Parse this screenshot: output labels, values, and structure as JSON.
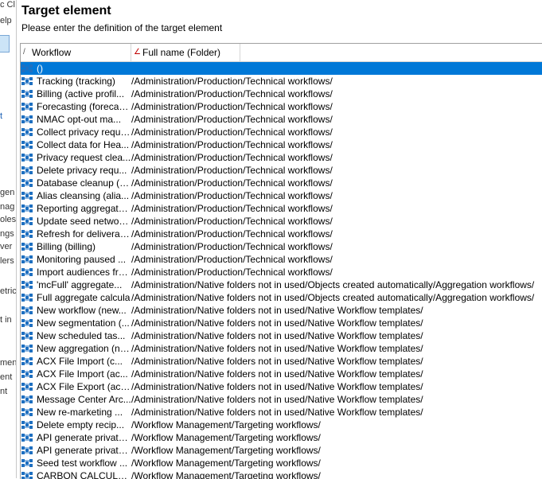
{
  "background_window": {
    "fragments": [
      "c Cl",
      "elp",
      "t",
      "gen",
      "nag",
      "oles",
      "ngs",
      "ver",
      "lers",
      "etric",
      "t in",
      "men",
      "ent",
      "nt"
    ]
  },
  "dialog": {
    "title": "Target element",
    "subtitle": "Please enter the definition of the target element"
  },
  "grid": {
    "columns": [
      {
        "label": "Workflow",
        "sort_glyph": "/"
      },
      {
        "label": "Full name (Folder)",
        "sort_glyph": "∠"
      }
    ],
    "selected_index": 0,
    "rows": [
      {
        "workflow": "()",
        "folder": ""
      },
      {
        "workflow": "Tracking (tracking)",
        "folder": "/Administration/Production/Technical workflows/"
      },
      {
        "workflow": "Billing (active profil...",
        "folder": "/Administration/Production/Technical workflows/"
      },
      {
        "workflow": "Forecasting (forecast...",
        "folder": "/Administration/Production/Technical workflows/"
      },
      {
        "workflow": "NMAC opt-out ma...",
        "folder": "/Administration/Production/Technical workflows/"
      },
      {
        "workflow": "Collect privacy reque...",
        "folder": "/Administration/Production/Technical workflows/"
      },
      {
        "workflow": "Collect data for Hea...",
        "folder": "/Administration/Production/Technical workflows/"
      },
      {
        "workflow": "Privacy request clea...",
        "folder": "/Administration/Production/Technical workflows/"
      },
      {
        "workflow": "Delete privacy requ...",
        "folder": "/Administration/Production/Technical workflows/"
      },
      {
        "workflow": "Database cleanup (cle",
        "folder": "/Administration/Production/Technical workflows/"
      },
      {
        "workflow": "Alias cleansing (alia...",
        "folder": "/Administration/Production/Technical workflows/"
      },
      {
        "workflow": "Reporting aggregate...",
        "folder": "/Administration/Production/Technical workflows/"
      },
      {
        "workflow": "Update seed network...",
        "folder": "/Administration/Production/Technical workflows/"
      },
      {
        "workflow": "Refresh for deliverab...",
        "folder": "/Administration/Production/Technical workflows/"
      },
      {
        "workflow": "Billing (billing)",
        "folder": "/Administration/Production/Technical workflows/"
      },
      {
        "workflow": "Monitoring paused ...",
        "folder": "/Administration/Production/Technical workflows/"
      },
      {
        "workflow": "Import audiences fro...",
        "folder": "/Administration/Production/Technical workflows/"
      },
      {
        "workflow": "'mcFull' aggregate...",
        "folder": "/Administration/Native folders not in used/Objects created automatically/Aggregation workflows/"
      },
      {
        "workflow": "Full aggregate calcula",
        "folder": "/Administration/Native folders not in used/Objects created automatically/Aggregation workflows/"
      },
      {
        "workflow": "New workflow (new...",
        "folder": "/Administration/Native folders not in used/Native Workflow templates/"
      },
      {
        "workflow": "New segmentation (...",
        "folder": "/Administration/Native folders not in used/Native Workflow templates/"
      },
      {
        "workflow": "New scheduled tas...",
        "folder": "/Administration/Native folders not in used/Native Workflow templates/"
      },
      {
        "workflow": "New aggregation (ne...",
        "folder": "/Administration/Native folders not in used/Native Workflow templates/"
      },
      {
        "workflow": "ACX File Import (c...",
        "folder": "/Administration/Native folders not in used/Native Workflow templates/"
      },
      {
        "workflow": "ACX File Import (ac...",
        "folder": "/Administration/Native folders not in used/Native Workflow templates/"
      },
      {
        "workflow": "ACX File Export (acxF...",
        "folder": "/Administration/Native folders not in used/Native Workflow templates/"
      },
      {
        "workflow": "Message Center Arc...",
        "folder": "/Administration/Native folders not in used/Native Workflow templates/"
      },
      {
        "workflow": "New re-marketing ...",
        "folder": "/Administration/Native folders not in used/Native Workflow templates/"
      },
      {
        "workflow": "Delete empty recip...",
        "folder": "/Workflow Management/Targeting workflows/"
      },
      {
        "workflow": "API generate private ..",
        "folder": "/Workflow Management/Targeting workflows/"
      },
      {
        "workflow": "API generate private ..",
        "folder": "/Workflow Management/Targeting workflows/"
      },
      {
        "workflow": "Seed test workflow ...",
        "folder": "/Workflow Management/Targeting workflows/"
      },
      {
        "workflow": "CARBON CALCULAT...",
        "folder": "/Workflow Management/Targeting workflows/"
      }
    ]
  },
  "colors": {
    "selection": "#0078d7",
    "workflow_icon": "#1e6fc0"
  },
  "icons": {
    "row_icon": "workflow-icon"
  }
}
